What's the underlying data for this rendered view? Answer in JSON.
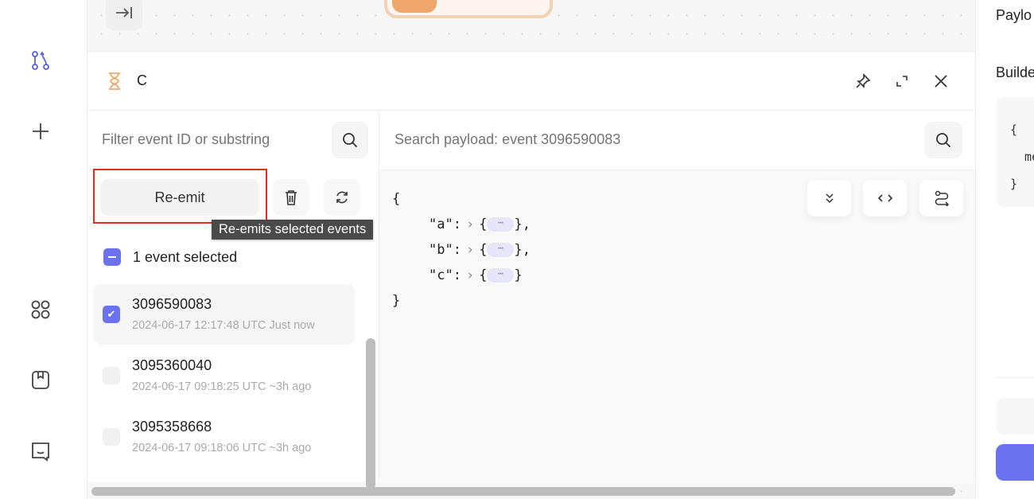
{
  "panel": {
    "title": "C"
  },
  "events": {
    "filter_placeholder": "Filter event ID or substring",
    "reemit_label": "Re-emit",
    "tooltip": "Re-emits selected events",
    "selected_count": "1 event selected",
    "items": [
      {
        "id": "3096590083",
        "timestamp": "2024-06-17 12:17:48 UTC Just now",
        "checked": true
      },
      {
        "id": "3095360040",
        "timestamp": "2024-06-17 09:18:25 UTC ~3h ago",
        "checked": false
      },
      {
        "id": "3095358668",
        "timestamp": "2024-06-17 09:18:06 UTC ~3h ago",
        "checked": false
      }
    ]
  },
  "payload": {
    "search_placeholder": "Search payload: event 3096590083",
    "open": "{",
    "close": "}",
    "lines": [
      {
        "key": "\"a\":",
        "tail": "},"
      },
      {
        "key": "\"b\":",
        "tail": "},"
      },
      {
        "key": "\"c\":",
        "tail": "}"
      }
    ],
    "ellipsis": "⋯"
  },
  "side": {
    "payload_label": "Paylo",
    "builder_label": "Builde",
    "code": "{\n  me\n}"
  },
  "colors": {
    "accent": "#6a72ef",
    "highlight": "#e0301e",
    "orange": "#eea86c"
  }
}
